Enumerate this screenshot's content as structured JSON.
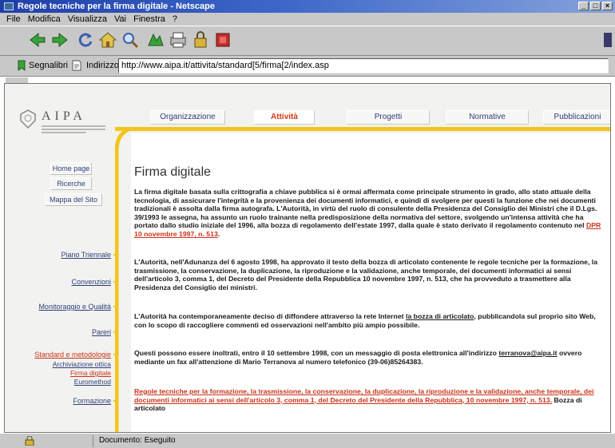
{
  "window": {
    "title": "Regole tecniche per la firma digitale - Netscape"
  },
  "menu": [
    "File",
    "Modifica",
    "Visualizza",
    "Vai",
    "Finestra",
    "?"
  ],
  "location": {
    "bookmarks_label": "Segnalibri",
    "label": "Indirizzo:",
    "url": "http://www.aipa.it/attivita/standard[5/firma[2/index.asp"
  },
  "logo": {
    "text": "AIPA"
  },
  "nav": [
    "Organizzazione",
    "Attività",
    "Progetti",
    "Normative",
    "Pubblicazioni"
  ],
  "side_buttons": [
    "Home page",
    "Ricerche",
    "Mappa del Sito"
  ],
  "side_links": [
    "Piano Triennale",
    "Convenzioni",
    "Monitoraggio e Qualità",
    "Pareri",
    "Standard e metodologie"
  ],
  "side_sublinks": [
    "Archiviazione ottica",
    "Firma digitale",
    "Euromethod",
    "Formazione"
  ],
  "page": {
    "title": "Firma digitale",
    "p1": "La firma digitale basata sulla crittografia a chiave pubblica si è ormai affermata come principale strumento in grado, allo stato attuale della tecnologia, di assicurare l'integrità e la provenienza dei documenti informatici, e quindi di svolgere per questi la funzione che nei documenti tradizionali è assolta dalla firma autografa. L'Autorità, in virtù del ruolo di consulente della Presidenza del Consiglio dei Ministri che il D.Lgs. 39/1993 le assegna, ha assunto un ruolo trainante nella predisposizione della normativa del settore, svolgendo un'intensa attività che ha portato dallo studio iniziale del 1996, alla bozza di regolamento dell'estate 1997, dalla quale è stato derivato il regolamento contenuto nel",
    "p1_link": "DPR 10 novembre 1997, n. 513",
    "p2": "L'Autorità, nell'Adunanza del 6 agosto 1998, ha approvato il testo della bozza di articolato contenente le regole tecniche per la formazione, la trasmissione, la conservazione, la duplicazione, la riproduzione e la validazione, anche temporale, dei documenti informatici ai sensi dell'articolo 3, comma 1, del Decreto del Presidente della Repubblica 10 novembre 1997, n. 513, che ha provveduto a trasmettere alla Presidenza del Consiglio dei ministri.",
    "p3_pre": "L'Autorità ha contemporaneamente deciso di diffondere attraverso la rete Internet",
    "p3_link": "la bozza di articolato",
    "p3_post": ", pubblicandola sul proprio sito Web, con lo scopo di raccogliere commenti ed osservazioni nell'ambito più ampio possibile.",
    "p4_pre": "Questi possono essere inoltrati, entro il 10 settembre 1998, con un messaggio di posta elettronica all'indirizzo",
    "p4_email": "terranova@aipa.it",
    "p4_post": "ovvero mediante un fax all'attenzione di Mario Terranova al numero telefonico (39-06)85264383.",
    "p5_link": "Regole tecniche per la formazione, la trasmissione, la conservazione, la duplicazione, la riproduzione e la validazione, anche temporale, dei documenti informatici ai sensi dell'articolo 3, comma 1, del Decreto del Presidente della Repubblica, 10 novembre 1997, n. 513.",
    "p5_post": "Bozza di articolato"
  },
  "status": {
    "text": "Documento: Eseguito"
  },
  "colors": {
    "accent_yellow": "#f1c51c",
    "link_red": "#c8341a",
    "nav_blue": "#2d3f7a"
  }
}
